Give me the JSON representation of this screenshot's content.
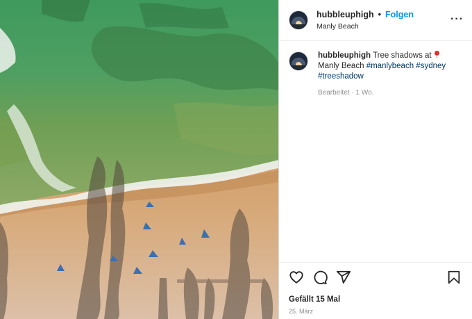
{
  "post": {
    "username": "hubbleuphigh",
    "follow_label": "Folgen",
    "location": "Manly Beach",
    "more_icon": "more-horizontal-icon",
    "caption": {
      "text_before": "Tree shadows at",
      "text_after": "Manly Beach",
      "hashtags": [
        "#manlybeach",
        "#sydney",
        "#treeshadow"
      ],
      "emoji": "round-pushpin"
    },
    "edited_label": "Bearbeitet · 1 Wo.",
    "likes_label": "Gefällt 15 Mal",
    "date_label": "25. März",
    "icons": [
      "heart-icon",
      "comment-icon",
      "share-icon",
      "bookmark-icon"
    ]
  },
  "colors": {
    "accent_blue": "#0095f6",
    "hashtag_blue": "#00376b",
    "muted_gray": "#8e8e8e"
  }
}
